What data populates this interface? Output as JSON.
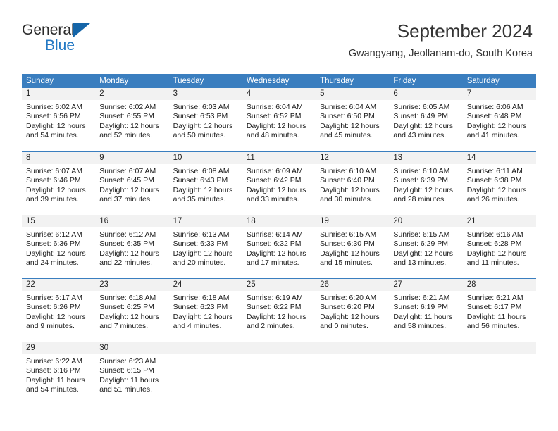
{
  "brand": {
    "name_top": "General",
    "name_bottom": "Blue",
    "accent_color": "#2479c4",
    "triangle_color": "#1565a8"
  },
  "header": {
    "title": "September 2024",
    "subtitle": "Gwangyang, Jeollanam-do, South Korea"
  },
  "calendar": {
    "header_bg": "#3a7ebf",
    "day_band_bg": "#f2f2f2",
    "weekdays": [
      "Sunday",
      "Monday",
      "Tuesday",
      "Wednesday",
      "Thursday",
      "Friday",
      "Saturday"
    ],
    "weeks": [
      [
        {
          "day": "1",
          "sunrise": "Sunrise: 6:02 AM",
          "sunset": "Sunset: 6:56 PM",
          "daylight": "Daylight: 12 hours and 54 minutes."
        },
        {
          "day": "2",
          "sunrise": "Sunrise: 6:02 AM",
          "sunset": "Sunset: 6:55 PM",
          "daylight": "Daylight: 12 hours and 52 minutes."
        },
        {
          "day": "3",
          "sunrise": "Sunrise: 6:03 AM",
          "sunset": "Sunset: 6:53 PM",
          "daylight": "Daylight: 12 hours and 50 minutes."
        },
        {
          "day": "4",
          "sunrise": "Sunrise: 6:04 AM",
          "sunset": "Sunset: 6:52 PM",
          "daylight": "Daylight: 12 hours and 48 minutes."
        },
        {
          "day": "5",
          "sunrise": "Sunrise: 6:04 AM",
          "sunset": "Sunset: 6:50 PM",
          "daylight": "Daylight: 12 hours and 45 minutes."
        },
        {
          "day": "6",
          "sunrise": "Sunrise: 6:05 AM",
          "sunset": "Sunset: 6:49 PM",
          "daylight": "Daylight: 12 hours and 43 minutes."
        },
        {
          "day": "7",
          "sunrise": "Sunrise: 6:06 AM",
          "sunset": "Sunset: 6:48 PM",
          "daylight": "Daylight: 12 hours and 41 minutes."
        }
      ],
      [
        {
          "day": "8",
          "sunrise": "Sunrise: 6:07 AM",
          "sunset": "Sunset: 6:46 PM",
          "daylight": "Daylight: 12 hours and 39 minutes."
        },
        {
          "day": "9",
          "sunrise": "Sunrise: 6:07 AM",
          "sunset": "Sunset: 6:45 PM",
          "daylight": "Daylight: 12 hours and 37 minutes."
        },
        {
          "day": "10",
          "sunrise": "Sunrise: 6:08 AM",
          "sunset": "Sunset: 6:43 PM",
          "daylight": "Daylight: 12 hours and 35 minutes."
        },
        {
          "day": "11",
          "sunrise": "Sunrise: 6:09 AM",
          "sunset": "Sunset: 6:42 PM",
          "daylight": "Daylight: 12 hours and 33 minutes."
        },
        {
          "day": "12",
          "sunrise": "Sunrise: 6:10 AM",
          "sunset": "Sunset: 6:40 PM",
          "daylight": "Daylight: 12 hours and 30 minutes."
        },
        {
          "day": "13",
          "sunrise": "Sunrise: 6:10 AM",
          "sunset": "Sunset: 6:39 PM",
          "daylight": "Daylight: 12 hours and 28 minutes."
        },
        {
          "day": "14",
          "sunrise": "Sunrise: 6:11 AM",
          "sunset": "Sunset: 6:38 PM",
          "daylight": "Daylight: 12 hours and 26 minutes."
        }
      ],
      [
        {
          "day": "15",
          "sunrise": "Sunrise: 6:12 AM",
          "sunset": "Sunset: 6:36 PM",
          "daylight": "Daylight: 12 hours and 24 minutes."
        },
        {
          "day": "16",
          "sunrise": "Sunrise: 6:12 AM",
          "sunset": "Sunset: 6:35 PM",
          "daylight": "Daylight: 12 hours and 22 minutes."
        },
        {
          "day": "17",
          "sunrise": "Sunrise: 6:13 AM",
          "sunset": "Sunset: 6:33 PM",
          "daylight": "Daylight: 12 hours and 20 minutes."
        },
        {
          "day": "18",
          "sunrise": "Sunrise: 6:14 AM",
          "sunset": "Sunset: 6:32 PM",
          "daylight": "Daylight: 12 hours and 17 minutes."
        },
        {
          "day": "19",
          "sunrise": "Sunrise: 6:15 AM",
          "sunset": "Sunset: 6:30 PM",
          "daylight": "Daylight: 12 hours and 15 minutes."
        },
        {
          "day": "20",
          "sunrise": "Sunrise: 6:15 AM",
          "sunset": "Sunset: 6:29 PM",
          "daylight": "Daylight: 12 hours and 13 minutes."
        },
        {
          "day": "21",
          "sunrise": "Sunrise: 6:16 AM",
          "sunset": "Sunset: 6:28 PM",
          "daylight": "Daylight: 12 hours and 11 minutes."
        }
      ],
      [
        {
          "day": "22",
          "sunrise": "Sunrise: 6:17 AM",
          "sunset": "Sunset: 6:26 PM",
          "daylight": "Daylight: 12 hours and 9 minutes."
        },
        {
          "day": "23",
          "sunrise": "Sunrise: 6:18 AM",
          "sunset": "Sunset: 6:25 PM",
          "daylight": "Daylight: 12 hours and 7 minutes."
        },
        {
          "day": "24",
          "sunrise": "Sunrise: 6:18 AM",
          "sunset": "Sunset: 6:23 PM",
          "daylight": "Daylight: 12 hours and 4 minutes."
        },
        {
          "day": "25",
          "sunrise": "Sunrise: 6:19 AM",
          "sunset": "Sunset: 6:22 PM",
          "daylight": "Daylight: 12 hours and 2 minutes."
        },
        {
          "day": "26",
          "sunrise": "Sunrise: 6:20 AM",
          "sunset": "Sunset: 6:20 PM",
          "daylight": "Daylight: 12 hours and 0 minutes."
        },
        {
          "day": "27",
          "sunrise": "Sunrise: 6:21 AM",
          "sunset": "Sunset: 6:19 PM",
          "daylight": "Daylight: 11 hours and 58 minutes."
        },
        {
          "day": "28",
          "sunrise": "Sunrise: 6:21 AM",
          "sunset": "Sunset: 6:17 PM",
          "daylight": "Daylight: 11 hours and 56 minutes."
        }
      ],
      [
        {
          "day": "29",
          "sunrise": "Sunrise: 6:22 AM",
          "sunset": "Sunset: 6:16 PM",
          "daylight": "Daylight: 11 hours and 54 minutes."
        },
        {
          "day": "30",
          "sunrise": "Sunrise: 6:23 AM",
          "sunset": "Sunset: 6:15 PM",
          "daylight": "Daylight: 11 hours and 51 minutes."
        },
        {
          "day": "",
          "sunrise": "",
          "sunset": "",
          "daylight": ""
        },
        {
          "day": "",
          "sunrise": "",
          "sunset": "",
          "daylight": ""
        },
        {
          "day": "",
          "sunrise": "",
          "sunset": "",
          "daylight": ""
        },
        {
          "day": "",
          "sunrise": "",
          "sunset": "",
          "daylight": ""
        },
        {
          "day": "",
          "sunrise": "",
          "sunset": "",
          "daylight": ""
        }
      ]
    ]
  }
}
